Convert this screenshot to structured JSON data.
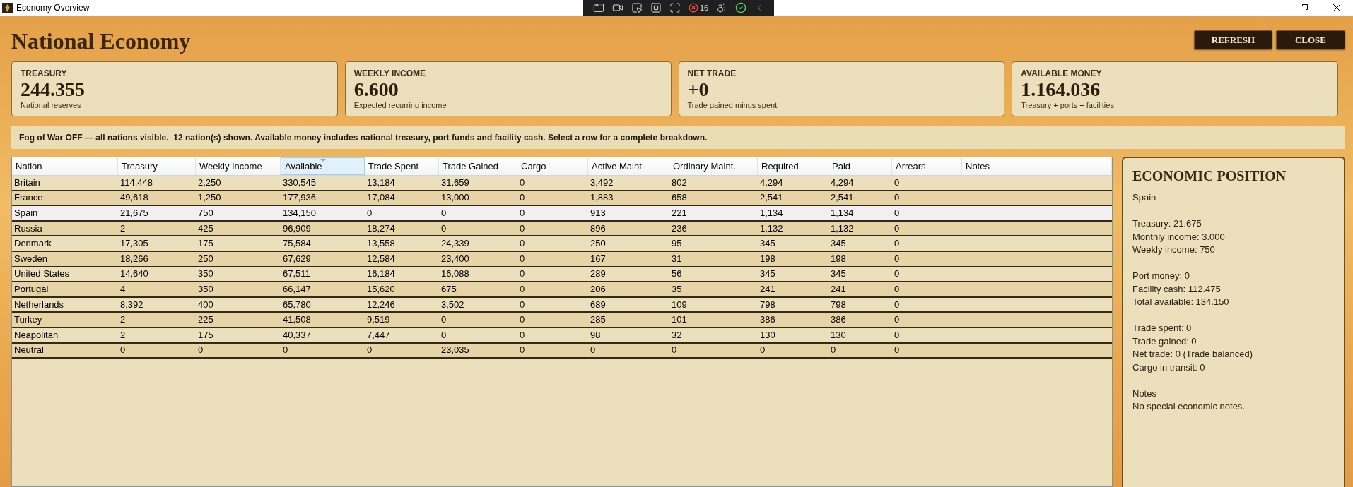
{
  "window": {
    "title": "Economy Overview"
  },
  "debug_toolbar": {
    "counter": "16"
  },
  "header": {
    "title": "National Economy",
    "buttons": [
      "REFRESH",
      "CLOSE"
    ]
  },
  "summary_cards": [
    {
      "label": "TREASURY",
      "value": "244.355",
      "caption": "National reserves"
    },
    {
      "label": "WEEKLY INCOME",
      "value": "6.600",
      "caption": "Expected recurring income"
    },
    {
      "label": "NET TRADE",
      "value": "+0",
      "caption": "Trade gained minus spent"
    },
    {
      "label": "AVAILABLE MONEY",
      "value": "1.164.036",
      "caption": "Treasury + ports + facilities"
    }
  ],
  "info_bar": {
    "text": "Fog of War OFF — all nations visible.  12 nation(s) shown. Available money includes national treasury, port funds and facility cash. Select a row for a complete breakdown."
  },
  "table": {
    "columns": [
      {
        "label": "Nation",
        "sorted": false
      },
      {
        "label": "Treasury",
        "sorted": false
      },
      {
        "label": "Weekly Income",
        "sorted": false
      },
      {
        "label": "Available",
        "sorted": true
      },
      {
        "label": "Trade Spent",
        "sorted": false
      },
      {
        "label": "Trade Gained",
        "sorted": false
      },
      {
        "label": "Cargo",
        "sorted": false
      },
      {
        "label": "Active Maint.",
        "sorted": false
      },
      {
        "label": "Ordinary Maint.",
        "sorted": false
      },
      {
        "label": "Required",
        "sorted": false
      },
      {
        "label": "Paid",
        "sorted": false
      },
      {
        "label": "Arrears",
        "sorted": false
      },
      {
        "label": "Notes",
        "sorted": false
      }
    ],
    "rows": [
      {
        "selected": false,
        "cells": [
          "Britain",
          "114,448",
          "2,250",
          "330,545",
          "13,184",
          "31,659",
          "0",
          "3,492",
          "802",
          "4,294",
          "4,294",
          "0"
        ]
      },
      {
        "selected": false,
        "cells": [
          "France",
          "49,618",
          "1,250",
          "177,936",
          "17,084",
          "13,000",
          "0",
          "1,883",
          "658",
          "2,541",
          "2,541",
          "0"
        ]
      },
      {
        "selected": true,
        "cells": [
          "Spain",
          "21,675",
          "750",
          "134,150",
          "0",
          "0",
          "0",
          "913",
          "221",
          "1,134",
          "1,134",
          "0"
        ]
      },
      {
        "selected": false,
        "cells": [
          "Russia",
          "2",
          "425",
          "96,909",
          "18,274",
          "0",
          "0",
          "896",
          "236",
          "1,132",
          "1,132",
          "0"
        ]
      },
      {
        "selected": false,
        "cells": [
          "Denmark",
          "17,305",
          "175",
          "75,584",
          "13,558",
          "24,339",
          "0",
          "250",
          "95",
          "345",
          "345",
          "0"
        ]
      },
      {
        "selected": false,
        "cells": [
          "Sweden",
          "18,266",
          "250",
          "67,629",
          "12,584",
          "23,400",
          "0",
          "167",
          "31",
          "198",
          "198",
          "0"
        ]
      },
      {
        "selected": false,
        "cells": [
          "United States",
          "14,640",
          "350",
          "67,511",
          "16,184",
          "16,088",
          "0",
          "289",
          "56",
          "345",
          "345",
          "0"
        ]
      },
      {
        "selected": false,
        "cells": [
          "Portugal",
          "4",
          "350",
          "66,147",
          "15,620",
          "675",
          "0",
          "206",
          "35",
          "241",
          "241",
          "0"
        ]
      },
      {
        "selected": false,
        "cells": [
          "Netherlands",
          "8,392",
          "400",
          "65,780",
          "12,246",
          "3,502",
          "0",
          "689",
          "109",
          "798",
          "798",
          "0"
        ]
      },
      {
        "selected": false,
        "cells": [
          "Turkey",
          "2",
          "225",
          "41,508",
          "9,519",
          "0",
          "0",
          "285",
          "101",
          "386",
          "386",
          "0"
        ]
      },
      {
        "selected": false,
        "cells": [
          "Neapolitan",
          "2",
          "175",
          "40,337",
          "7,447",
          "0",
          "0",
          "98",
          "32",
          "130",
          "130",
          "0"
        ]
      },
      {
        "selected": false,
        "cells": [
          "Neutral",
          "0",
          "0",
          "0",
          "0",
          "23,035",
          "0",
          "0",
          "0",
          "0",
          "0",
          "0"
        ]
      }
    ]
  },
  "details_panel": {
    "title": "ECONOMIC POSITION",
    "nation": "Spain",
    "sections": [
      [
        "Treasury: 21.675",
        "Monthly income: 3.000",
        "Weekly income: 750"
      ],
      [
        "Port money: 0",
        "Facility cash: 112.475",
        "Total available: 134.150"
      ],
      [
        "Trade spent: 0",
        "Trade gained: 0",
        "Net trade: 0 (Trade balanced)",
        "Cargo in transit: 0"
      ],
      [
        "Notes",
        "No special economic notes."
      ]
    ]
  }
}
